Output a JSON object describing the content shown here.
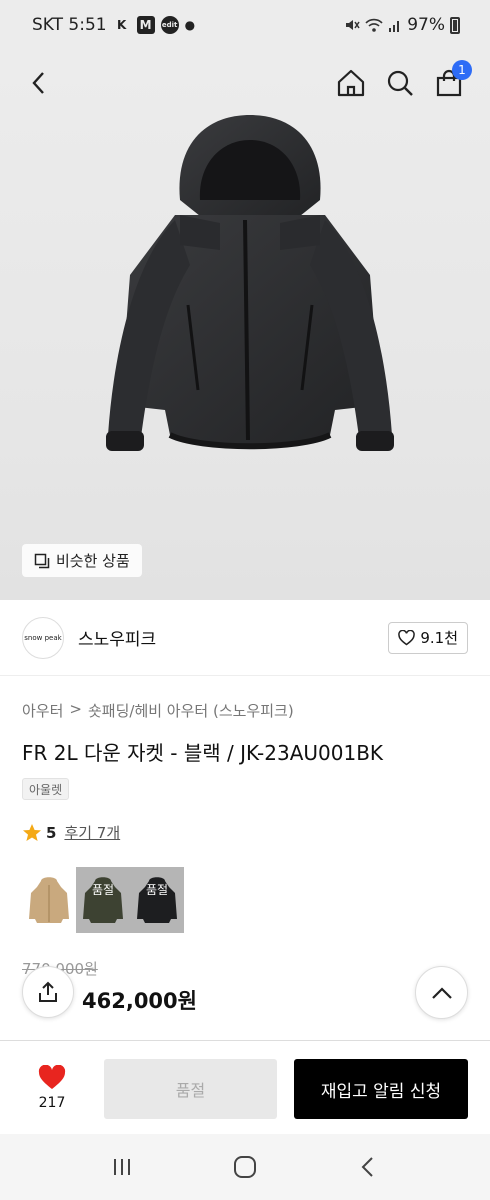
{
  "status_bar": {
    "carrier_time": "SKT 5:51",
    "app_icons": [
      "K",
      "M",
      "edit"
    ],
    "battery": "97%"
  },
  "header": {
    "back_icon": "chevron-left-icon",
    "home_icon": "home-icon",
    "search_icon": "search-icon",
    "cart_icon": "shopping-bag-icon",
    "cart_badge": "1"
  },
  "hero": {
    "similar_products_label": "비슷한 상품"
  },
  "brand": {
    "logo_text": "snow peak",
    "name": "스노우피크",
    "likes": "9.1천"
  },
  "breadcrumb": {
    "level1": "아우터",
    "separator": ">",
    "level2": "숏패딩/헤비 아우터 (스노우피크)"
  },
  "product": {
    "title": "FR 2L 다운 자켓 - 블랙 / JK-23AU001BK",
    "tag": "아울렛",
    "rating": "5",
    "reviews": "후기 7개",
    "options": [
      {
        "color": "beige",
        "label": ""
      },
      {
        "color": "khaki",
        "label": "품절"
      },
      {
        "color": "black",
        "label": "품절"
      }
    ],
    "original_price": "770,000원",
    "sale_price": "462,000원"
  },
  "action_bar": {
    "wish_count": "217",
    "soldout_label": "품절",
    "restock_label": "재입고 알림 신청"
  },
  "colors": {
    "badge": "#2e6cf6",
    "heart": "#e8251f",
    "star": "#f4a916",
    "primary_button": "#000000"
  }
}
